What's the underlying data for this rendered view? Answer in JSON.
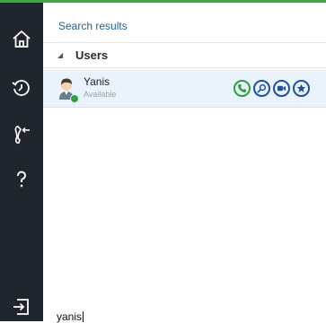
{
  "search_results_title": "Search results",
  "group": {
    "label": "Users",
    "expanded": true
  },
  "contact": {
    "name": "Yanis",
    "status": "Available",
    "presence_color": "#2f9d41"
  },
  "contact_actions": [
    "phone-icon",
    "search-icon",
    "video-icon",
    "star-icon"
  ],
  "sidebar_icons": [
    "home-icon",
    "history-icon",
    "transfer-icon",
    "help-icon",
    "logout-icon"
  ],
  "search": {
    "value": "yanis"
  },
  "colors": {
    "sidebar": "#20262d",
    "accent": "#4b9e4f",
    "link": "#1b5f9d",
    "selected_row": "#eaf3fb"
  }
}
